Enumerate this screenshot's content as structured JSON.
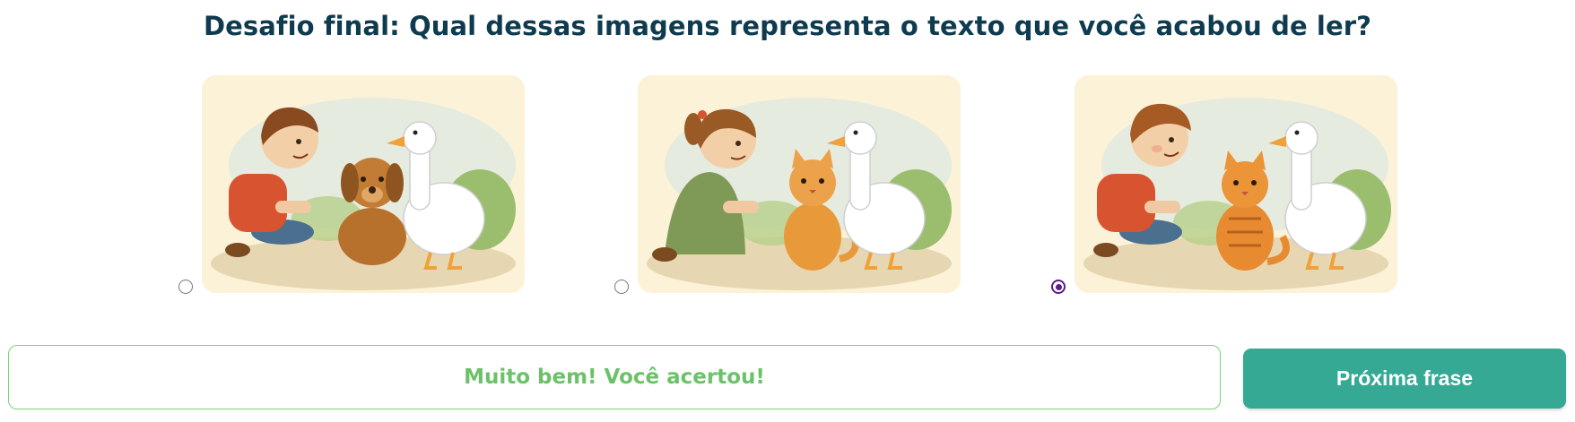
{
  "question": {
    "title": "Desafio final: Qual dessas imagens representa o texto que você acabou de ler?"
  },
  "options": [
    {
      "id": "option-1",
      "illustration": "boy-dog-duck-illustration",
      "selected": false
    },
    {
      "id": "option-2",
      "illustration": "girl-cat-duck-illustration",
      "selected": false
    },
    {
      "id": "option-3",
      "illustration": "boy-cat-duck-illustration",
      "selected": true
    }
  ],
  "feedback": {
    "message": "Muito bem! Você acertou!",
    "color": "#6cc16a",
    "border_color": "#7ed07a"
  },
  "actions": {
    "next_label": "Próxima frase",
    "next_color": "#35a994"
  },
  "colors": {
    "title": "#0e3b4f",
    "radio_selected": "#5b1e8a",
    "card_background": "#fbf2d7"
  }
}
